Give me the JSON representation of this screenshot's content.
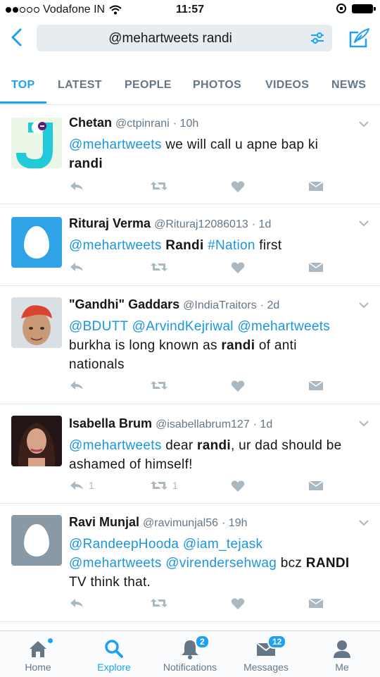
{
  "status_bar": {
    "carrier": "Vodafone IN",
    "time": "11:57"
  },
  "search": {
    "query": "@mehartweets randi"
  },
  "tabs": [
    {
      "label": "TOP"
    },
    {
      "label": "LATEST"
    },
    {
      "label": "PEOPLE"
    },
    {
      "label": "PHOTOS"
    },
    {
      "label": "VIDEOS"
    },
    {
      "label": "NEWS"
    }
  ],
  "active_tab": "TOP",
  "tweets": [
    {
      "name": "Chetan",
      "handle": "@ctpinrani",
      "time": "· 10h",
      "avatar": "j-logo-avatar",
      "text_parts": [
        {
          "t": "@mehartweets",
          "style": "link"
        },
        {
          "t": " we will call u apne bap ki ",
          "style": "plain"
        },
        {
          "t": "randi",
          "style": "bold"
        }
      ],
      "reply_count": "",
      "retweet_count": ""
    },
    {
      "name": "Rituraj Verma",
      "handle": "@Rituraj12086013",
      "time": "· 1d",
      "avatar": "egg-avatar",
      "text_parts": [
        {
          "t": "@mehartweets",
          "style": "link"
        },
        {
          "t": " ",
          "style": "plain"
        },
        {
          "t": "Randi",
          "style": "bold"
        },
        {
          "t": " ",
          "style": "plain"
        },
        {
          "t": "#Nation",
          "style": "link"
        },
        {
          "t": " first",
          "style": "plain"
        }
      ],
      "reply_count": "",
      "retweet_count": ""
    },
    {
      "name": "\"Gandhi\" Gaddars",
      "handle": "@IndiaTraitors",
      "time": "· 2d",
      "avatar": "photo-avatar",
      "text_parts": [
        {
          "t": "@BDUTT",
          "style": "link"
        },
        {
          "t": " ",
          "style": "plain"
        },
        {
          "t": "@ArvindKejriwal",
          "style": "link"
        },
        {
          "t": " ",
          "style": "plain"
        },
        {
          "t": "@mehartweets",
          "style": "link"
        },
        {
          "t": " burkha is long known as ",
          "style": "plain"
        },
        {
          "t": "randi",
          "style": "bold"
        },
        {
          "t": " of anti nationals",
          "style": "plain"
        }
      ],
      "reply_count": "",
      "retweet_count": ""
    },
    {
      "name": "Isabella Brum",
      "handle": "@isabellabrum127",
      "time": "· 1d",
      "avatar": "photo-avatar",
      "text_parts": [
        {
          "t": "@mehartweets",
          "style": "link"
        },
        {
          "t": " dear ",
          "style": "plain"
        },
        {
          "t": "randi",
          "style": "bold"
        },
        {
          "t": ", ur dad should be ashamed of himself!",
          "style": "plain"
        }
      ],
      "reply_count": "1",
      "retweet_count": "1"
    },
    {
      "name": "Ravi Munjal",
      "handle": "@ravimunjal56",
      "time": "· 19h",
      "avatar": "egg-avatar",
      "text_parts": [
        {
          "t": "@RandeepHooda",
          "style": "link"
        },
        {
          "t": " ",
          "style": "plain"
        },
        {
          "t": "@iam_tejask",
          "style": "link"
        },
        {
          "t": " ",
          "style": "plain"
        },
        {
          "t": "@mehartweets",
          "style": "link"
        },
        {
          "t": " ",
          "style": "plain"
        },
        {
          "t": "@virendersehwag",
          "style": "link"
        },
        {
          "t": " bcz ",
          "style": "plain"
        },
        {
          "t": "RANDI",
          "style": "bold"
        },
        {
          "t": " TV think that.",
          "style": "plain"
        }
      ],
      "reply_count": "",
      "retweet_count": ""
    }
  ],
  "bottom_nav": [
    {
      "label": "Home",
      "badge": ""
    },
    {
      "label": "Explore",
      "badge": ""
    },
    {
      "label": "Notifications",
      "badge": "2"
    },
    {
      "label": "Messages",
      "badge": "12"
    },
    {
      "label": "Me",
      "badge": ""
    }
  ],
  "colors": {
    "accent": "#1da1f2",
    "link": "#1b95e0",
    "muted": "#657786",
    "icon": "#aab8c2"
  }
}
